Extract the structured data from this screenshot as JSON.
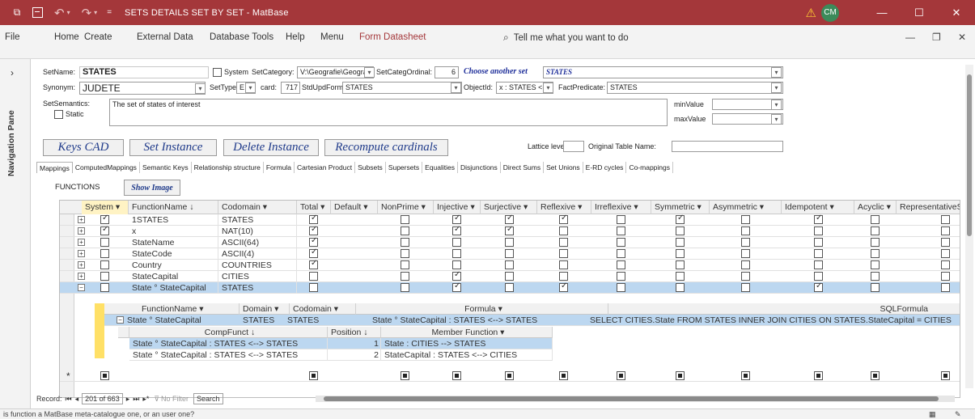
{
  "titlebar": {
    "quick_access_label": "=",
    "title": "SETS DETAILS SET BY SET - MatBase",
    "user_initials": "CM"
  },
  "ribbon": {
    "tabs": [
      "File",
      "Home",
      "Create",
      "External Data",
      "Database Tools",
      "Help",
      "Menu",
      "Form Datasheet"
    ],
    "tell_me": "Tell me what you want to do"
  },
  "nav_pane": {
    "label": "Navigation Pane"
  },
  "form": {
    "setname_label": "SetName:",
    "setname_value": "STATES",
    "system_label": "System",
    "setcategory_label": "SetCategory:",
    "setcategory_value": "V:\\Geografie\\Geografie",
    "setcategordinal_label": "SetCategOrdinal:",
    "setcategordinal_value": "6",
    "choose_another_set": "Choose another set",
    "choose_value": "STATES",
    "synonym_label": "Synonym:",
    "synonym_value": "JUDETE",
    "settype_label": "SetType:",
    "settype_value": "E",
    "card_label": "card:",
    "card_value": "717",
    "stdupdform_label": "StdUpdForm:",
    "stdupdform_value": "STATES",
    "objectid_label": "ObjectId:",
    "objectid_value": "x : STATES <--> N",
    "factpredicate_label": "FactPredicate:",
    "factpredicate_value": "STATES",
    "setsemantics_label": "SetSemantics:",
    "setsemantics_value": "The set of states of interest",
    "static_label": "Static",
    "minvalue_label": "minValue",
    "maxvalue_label": "maxValue",
    "lattice_label": "Lattice level",
    "original_table_label": "Original Table Name:"
  },
  "buttons": {
    "keys_cad": "Keys CAD",
    "set_instance": "Set Instance",
    "delete_instance": "Delete Instance",
    "recompute": "Recompute cardinals"
  },
  "subtabs": [
    "Mappings",
    "ComputedMappings",
    "Semantic Keys",
    "Relationship structure",
    "Formula",
    "Cartesian Product",
    "Subsets",
    "Supersets",
    "Equalities",
    "Disjunctions",
    "Direct Sums",
    "Set Unions",
    "E-RD cycles",
    "Co-mappings"
  ],
  "functions_label": "FUNCTIONS",
  "show_image": "Show Image",
  "grid": {
    "headers": [
      "System",
      "FunctionName",
      "Codomain",
      "Total",
      "Default",
      "NonPrime",
      "Injective",
      "Surjective",
      "Reflexive",
      "Irreflexive",
      "Symmetric",
      "Asymmetric",
      "Idempotent",
      "Acyclic",
      "RepresentativeSy"
    ],
    "rows": [
      {
        "system": true,
        "name": "1STATES",
        "codomain": "STATES",
        "total": true,
        "nonprime": false,
        "injective": true,
        "surjective": true,
        "reflexive": true,
        "irreflexive": false,
        "symmetric": true,
        "asymmetric": false,
        "idempotent": true,
        "acyclic": false,
        "rep": false
      },
      {
        "system": true,
        "name": "x",
        "codomain": "NAT(10)",
        "total": true,
        "nonprime": false,
        "injective": true,
        "surjective": true,
        "reflexive": false,
        "irreflexive": false,
        "symmetric": false,
        "asymmetric": false,
        "idempotent": false,
        "acyclic": false,
        "rep": false
      },
      {
        "system": false,
        "name": "StateName",
        "codomain": "ASCII(64)",
        "total": true,
        "nonprime": false,
        "injective": false,
        "surjective": false,
        "reflexive": false,
        "irreflexive": false,
        "symmetric": false,
        "asymmetric": false,
        "idempotent": false,
        "acyclic": false,
        "rep": false
      },
      {
        "system": false,
        "name": "StateCode",
        "codomain": "ASCII(4)",
        "total": true,
        "nonprime": false,
        "injective": false,
        "surjective": false,
        "reflexive": false,
        "irreflexive": false,
        "symmetric": false,
        "asymmetric": false,
        "idempotent": false,
        "acyclic": false,
        "rep": false
      },
      {
        "system": false,
        "name": "Country",
        "codomain": "COUNTRIES",
        "total": true,
        "nonprime": false,
        "injective": false,
        "surjective": false,
        "reflexive": false,
        "irreflexive": false,
        "symmetric": false,
        "asymmetric": false,
        "idempotent": false,
        "acyclic": false,
        "rep": false
      },
      {
        "system": false,
        "name": "StateCapital",
        "codomain": "CITIES",
        "total": false,
        "nonprime": false,
        "injective": true,
        "surjective": false,
        "reflexive": false,
        "irreflexive": false,
        "symmetric": false,
        "asymmetric": false,
        "idempotent": false,
        "acyclic": false,
        "rep": false
      },
      {
        "system": false,
        "name": "State ° StateCapital",
        "codomain": "STATES",
        "total": false,
        "nonprime": false,
        "injective": true,
        "surjective": false,
        "reflexive": true,
        "irreflexive": false,
        "symmetric": false,
        "asymmetric": false,
        "idempotent": true,
        "acyclic": false,
        "rep": false
      }
    ],
    "sub_headers": [
      "FunctionName",
      "Domain",
      "Codomain",
      "Formula",
      "SQLFormula"
    ],
    "sub_row": {
      "name": "State ° StateCapital",
      "domain": "STATES",
      "codomain": "STATES",
      "formula": "State ° StateCapital : STATES <--> STATES",
      "sql": "SELECT CITIES.State FROM STATES INNER JOIN CITIES ON STATES.StateCapital = CITIES"
    },
    "sub2_headers": [
      "CompFunct",
      "Position",
      "Member Function"
    ],
    "sub2_rows": [
      {
        "comp": "State ° StateCapital : STATES <--> STATES",
        "pos": "1",
        "member": "State : CITIES --> STATES"
      },
      {
        "comp": "State ° StateCapital : STATES <--> STATES",
        "pos": "2",
        "member": "StateCapital : STATES <--> CITIES"
      }
    ]
  },
  "record_nav": {
    "label": "Record:",
    "value": "201 of 663",
    "filter": "No Filter",
    "search": "Search"
  },
  "status": "is function a MatBase meta-catalogue one, or an user one?"
}
